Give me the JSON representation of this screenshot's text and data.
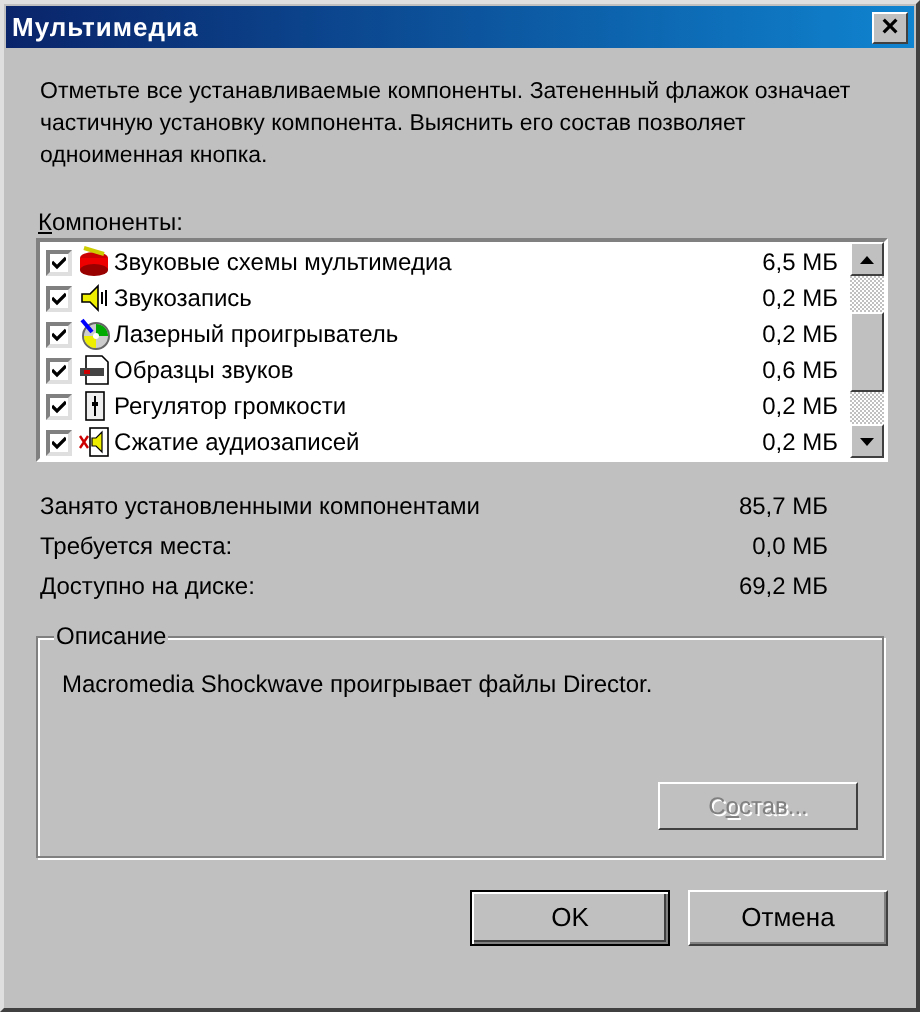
{
  "window": {
    "title": "Мультимедиа",
    "close": "×"
  },
  "intro": "Отметьте все устанавливаемые компоненты. Затененный флажок означает частичную установку компонента. Выяснить его состав позволяет одноименная кнопка.",
  "components_label": {
    "key": "К",
    "after": "омпоненты:"
  },
  "components": [
    {
      "name": "Звуковые схемы мультимедиа",
      "size": "6,5 МБ",
      "checked": true
    },
    {
      "name": "Звукозапись",
      "size": "0,2 МБ",
      "checked": true
    },
    {
      "name": "Лазерный проигрыватель",
      "size": "0,2 МБ",
      "checked": true
    },
    {
      "name": "Образцы звуков",
      "size": "0,6 МБ",
      "checked": true
    },
    {
      "name": "Регулятор громкости",
      "size": "0,2 МБ",
      "checked": true
    },
    {
      "name": "Сжатие аудиозаписей",
      "size": "0,2 МБ",
      "checked": true
    }
  ],
  "stats": [
    {
      "label": "Занято установленными компонентами",
      "value": "85,7 МБ"
    },
    {
      "label": "Требуется места:",
      "value": "0,0 МБ"
    },
    {
      "label": "Доступно на диске:",
      "value": "69,2 МБ"
    }
  ],
  "description": {
    "title": "Описание",
    "text": "Macromedia Shockwave проигрывает файлы Director.",
    "details_button": {
      "before": "С",
      "key": "о",
      "after": "став...",
      "disabled": true
    }
  },
  "buttons": [
    {
      "label": "OK",
      "default": true
    },
    {
      "label": "Отмена",
      "default": false
    }
  ]
}
